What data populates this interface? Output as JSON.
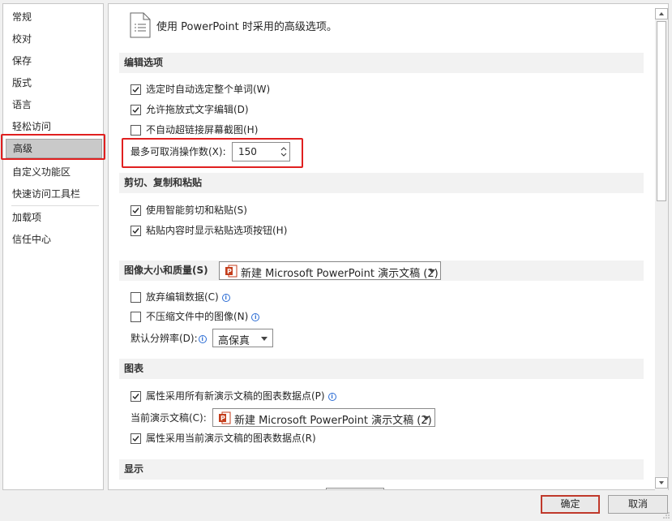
{
  "sidebar": {
    "items": [
      {
        "label": "常规"
      },
      {
        "label": "校对"
      },
      {
        "label": "保存"
      },
      {
        "label": "版式"
      },
      {
        "label": "语言"
      },
      {
        "label": "轻松访问"
      },
      {
        "label": "高级"
      },
      {
        "label": "自定义功能区"
      },
      {
        "label": "快速访问工具栏"
      },
      {
        "label": "加载项"
      },
      {
        "label": "信任中心"
      }
    ],
    "selected": "高级"
  },
  "header": {
    "title": "使用 PowerPoint 时采用的高级选项。"
  },
  "editing": {
    "title": "编辑选项",
    "auto_select_word": "选定时自动选定整个单词(W)",
    "drag_drop": "允许拖放式文字编辑(D)",
    "no_auto_hyperlink": "不自动超链接屏幕截图(H)",
    "undo_label": "最多可取消操作数(X):",
    "undo_value": "150"
  },
  "clipboard": {
    "title": "剪切、复制和粘贴",
    "smart_cut": "使用智能剪切和粘贴(S)",
    "show_paste_options": "粘贴内容时显示粘贴选项按钮(H)"
  },
  "image": {
    "title": "图像大小和质量(S)",
    "doc_select": "新建 Microsoft PowerPoint 演示文稿 (2)",
    "discard_editing": "放弃编辑数据(C)",
    "no_compress": "不压缩文件中的图像(N)",
    "resolution_label": "默认分辨率(D):",
    "resolution_value": "高保真"
  },
  "chart": {
    "title": "图表",
    "all_new_docs": "属性采用所有新演示文稿的图表数据点(P)",
    "current_doc_label": "当前演示文稿(C):",
    "current_doc_select": "新建 Microsoft PowerPoint 演示文稿 (2)",
    "current_doc_prop": "属性采用当前演示文稿的图表数据点(R)"
  },
  "display": {
    "title": "显示"
  },
  "buttons": {
    "ok": "确定",
    "cancel": "取消"
  }
}
